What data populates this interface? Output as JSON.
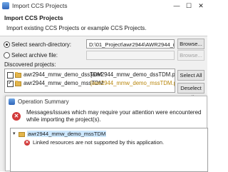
{
  "import_dialog": {
    "window_title": "Import CCS Projects",
    "header": {
      "title": "Import CCS Projects",
      "description": "Import existing CCS Projects or example CCS Projects."
    },
    "search_directory": {
      "label": "Select search-directory:",
      "selected": true,
      "value": "D:\\01_Project\\awr2944\\AWR2944_mmw_TDM_demo",
      "browse_label": "Browse..."
    },
    "archive_file": {
      "label": "Select archive file:",
      "selected": false,
      "value": "",
      "browse_label": "Browse..."
    },
    "discovered_projects_label": "Discovered projects:",
    "projects": [
      {
        "name": "awr2944_mmw_demo_dssTDM",
        "path": "[awr2944_mmw_demo_dssTDM.project]",
        "checked": false
      },
      {
        "name": "awr2944_mmw_demo_mssTDM",
        "path": "[awr2944_mmw_demo_mssTDM.projec",
        "checked": true
      }
    ],
    "select_all_label": "Select All",
    "deselect_all_label": "Deselect All",
    "window_controls": {
      "minimize": "—",
      "maximize": "☐",
      "close": "✕"
    }
  },
  "operation_summary": {
    "window_title": "Operation Summary",
    "message": "Messages/issues which may require your attention were encountered while importing the project(s).",
    "tree": {
      "project": {
        "expander": "▾",
        "name": "awr2944_mmw_demo_mssTDM"
      },
      "issues": [
        {
          "text": "Linked resources are not supported by this application."
        }
      ]
    }
  },
  "colors": {
    "error_red": "#d23a3a",
    "selection_blue": "#cde8ff",
    "warning_path": "#b8860b"
  },
  "icons": [
    "app-icon",
    "folder-icon",
    "error-icon",
    "checkbox",
    "radio"
  ]
}
